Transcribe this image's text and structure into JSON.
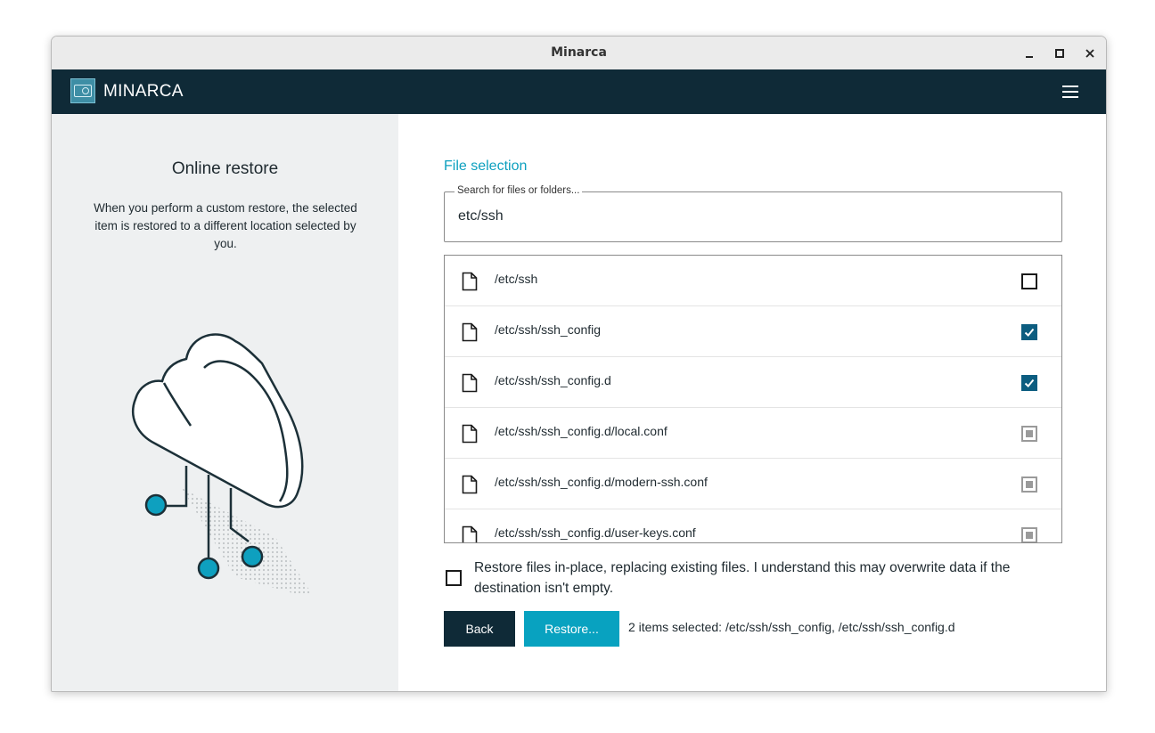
{
  "window": {
    "title": "Minarca"
  },
  "header": {
    "brand": "MINARCA"
  },
  "left_panel": {
    "title": "Online restore",
    "description": "When you perform a custom restore, the selected item is restored to a different location selected by you."
  },
  "file_selection": {
    "title": "File selection",
    "search_label": "Search for files or folders...",
    "search_value": "etc/ssh",
    "items": [
      {
        "path": "/etc/ssh",
        "state": "unchecked"
      },
      {
        "path": "/etc/ssh/ssh_config",
        "state": "checked"
      },
      {
        "path": "/etc/ssh/ssh_config.d",
        "state": "checked"
      },
      {
        "path": "/etc/ssh/ssh_config.d/local.conf",
        "state": "partial"
      },
      {
        "path": "/etc/ssh/ssh_config.d/modern-ssh.conf",
        "state": "partial"
      },
      {
        "path": "/etc/ssh/ssh_config.d/user-keys.conf",
        "state": "partial"
      }
    ]
  },
  "restore_in_place": {
    "label": "Restore files in-place, replacing existing files. I understand this may overwrite data if the destination isn't empty.",
    "checked": false
  },
  "actions": {
    "back_label": "Back",
    "restore_label": "Restore...",
    "status": "2 items selected: /etc/ssh/ssh_config, /etc/ssh/ssh_config.d"
  },
  "colors": {
    "header": "#0f2a37",
    "accent": "#08a2c0",
    "checkbox": "#0c5d80"
  }
}
